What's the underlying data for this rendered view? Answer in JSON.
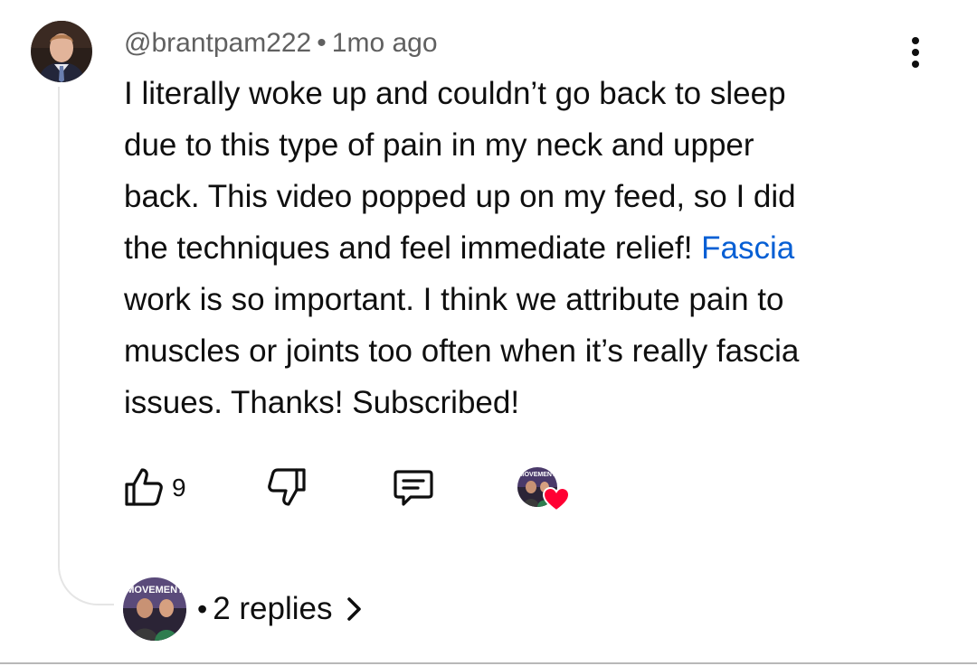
{
  "comment": {
    "author": "@brantpam222",
    "separator": "•",
    "timestamp": "1mo ago",
    "text_lines": [
      "I literally woke up and couldn’t go back to sleep",
      "due to this type of pain in my neck and upper",
      "back. This video popped up on my feed, so I did",
      "the techniques and feel immediate relief!",
      "Fascia",
      "work is so important. I think we attribute pain to",
      "muscles or joints too often when it’s really fascia",
      "issues. Thanks! Subscribed!"
    ],
    "avatar_icon": "user-avatar-photo",
    "menu_icon": "more-vert-icon"
  },
  "actions": {
    "like_icon": "thumbs-up-icon",
    "like_count": "9",
    "dislike_icon": "thumbs-down-icon",
    "reply_icon": "comment-reply-icon",
    "creator_heart_icon": "creator-heart-icon",
    "creator_badge_text": "MOVEMENT",
    "heart_color": "#ff0033"
  },
  "replies": {
    "separator": "•",
    "label": "2 replies",
    "chevron_icon": "chevron-right-icon",
    "channel_badge_text": "MOVEMENT"
  },
  "colors": {
    "text_primary": "#0f0f0f",
    "text_secondary": "#606060",
    "link": "#065fd4",
    "thread_line": "#e5e5e5"
  }
}
